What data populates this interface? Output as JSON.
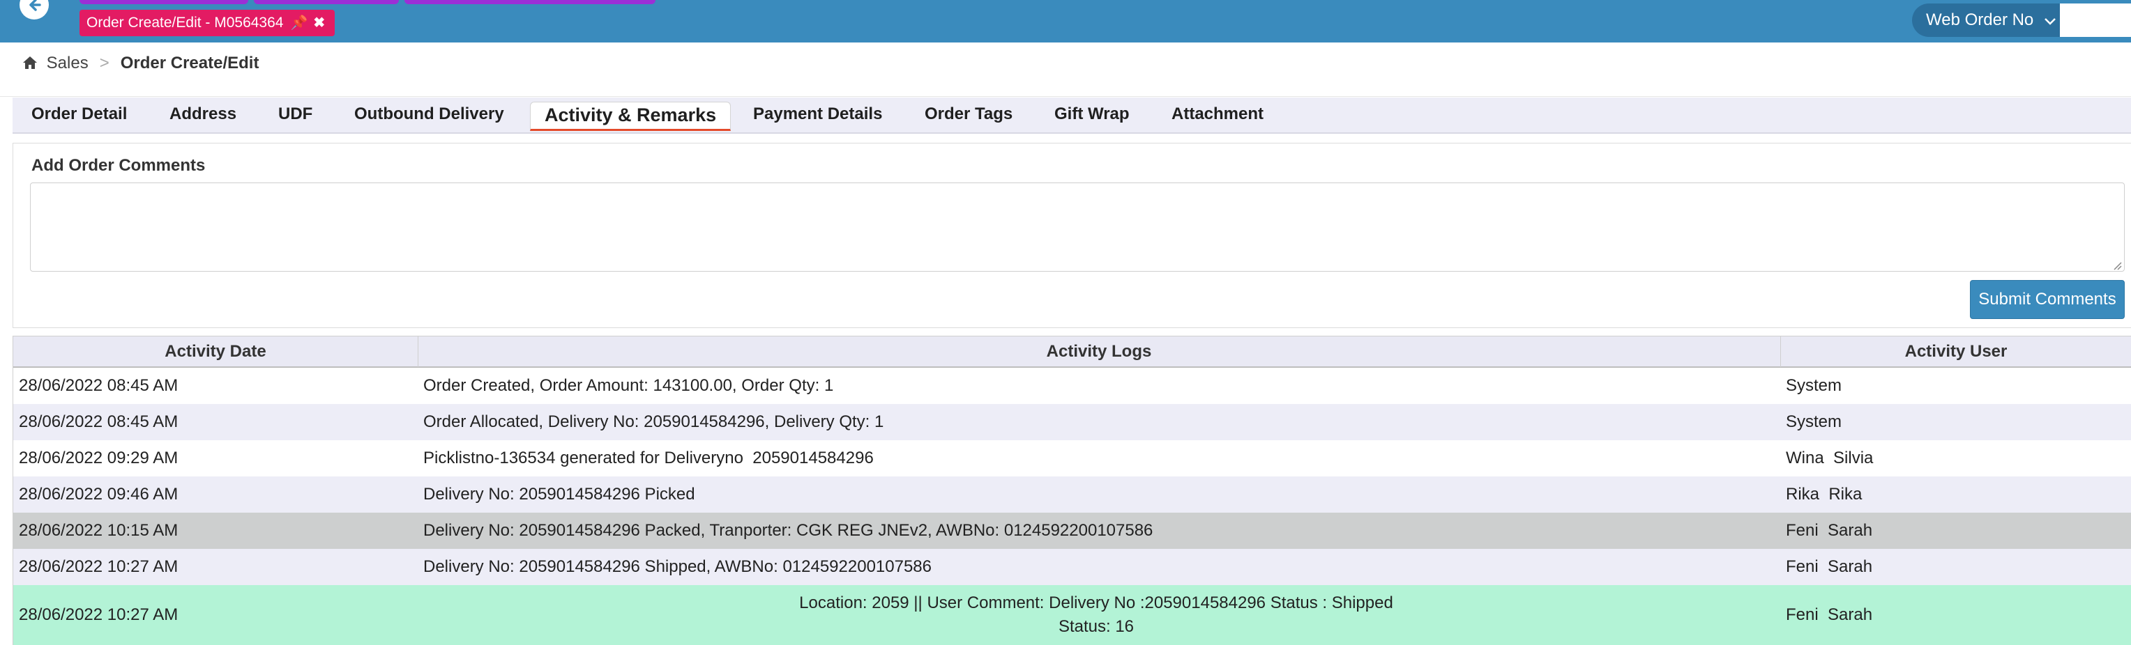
{
  "topbar": {
    "open_tab": {
      "label": "Order Create/Edit - M0564364",
      "pin_icon": "pin-icon",
      "close_icon": "close-icon"
    },
    "search_type": "Web Order No",
    "search_value": "",
    "colors": {
      "bar": "#3a8bbd",
      "active_tab": "#e31b63",
      "stub_tabs": "#9b2fd6"
    }
  },
  "breadcrumb": {
    "home_icon": "home-icon",
    "root": "Sales",
    "separator": ">",
    "current": "Order Create/Edit"
  },
  "tabs": [
    {
      "label": "Order Detail",
      "active": false
    },
    {
      "label": "Address",
      "active": false
    },
    {
      "label": "UDF",
      "active": false
    },
    {
      "label": "Outbound Delivery",
      "active": false
    },
    {
      "label": "Activity & Remarks",
      "active": true
    },
    {
      "label": "Payment Details",
      "active": false
    },
    {
      "label": "Order Tags",
      "active": false
    },
    {
      "label": "Gift Wrap",
      "active": false
    },
    {
      "label": "Attachment",
      "active": false
    }
  ],
  "comments": {
    "label": "Add Order Comments",
    "value": "",
    "submit_label": "Submit Comments"
  },
  "activity_table": {
    "columns": [
      "Activity Date",
      "Activity Logs",
      "Activity User"
    ],
    "rows": [
      {
        "date": "28/06/2022 08:45 AM",
        "log": "Order Created, Order Amount: 143100.00, Order Qty: 1",
        "user": "System"
      },
      {
        "date": "28/06/2022 08:45 AM",
        "log": "Order Allocated, Delivery No: 2059014584296, Delivery Qty: 1",
        "user": "System"
      },
      {
        "date": "28/06/2022 09:29 AM",
        "log": "Picklistno-136534 generated for Deliveryno  2059014584296",
        "user": "Wina  Silvia"
      },
      {
        "date": "28/06/2022 09:46 AM",
        "log": "Delivery No: 2059014584296 Picked",
        "user": "Rika  Rika"
      },
      {
        "date": "28/06/2022 10:15 AM",
        "log": "Delivery No: 2059014584296 Packed, Tranporter: CGK REG JNEv2, AWBNo: 0124592200107586",
        "user": "Feni  Sarah"
      },
      {
        "date": "28/06/2022 10:27 AM",
        "log": "Delivery No: 2059014584296 Shipped, AWBNo: 0124592200107586",
        "user": "Feni  Sarah"
      },
      {
        "date": "28/06/2022 10:27 AM",
        "log": "Location: 2059 || User Comment: Delivery No :2059014584296 Status : Shipped",
        "log_line2": "Status: 16",
        "user": "Feni  Sarah"
      }
    ],
    "row_colors": {
      "white": "#ffffff",
      "alt": "#ededf7",
      "highlight": "#cdcfcf",
      "comment": "#b3f3d6"
    }
  }
}
